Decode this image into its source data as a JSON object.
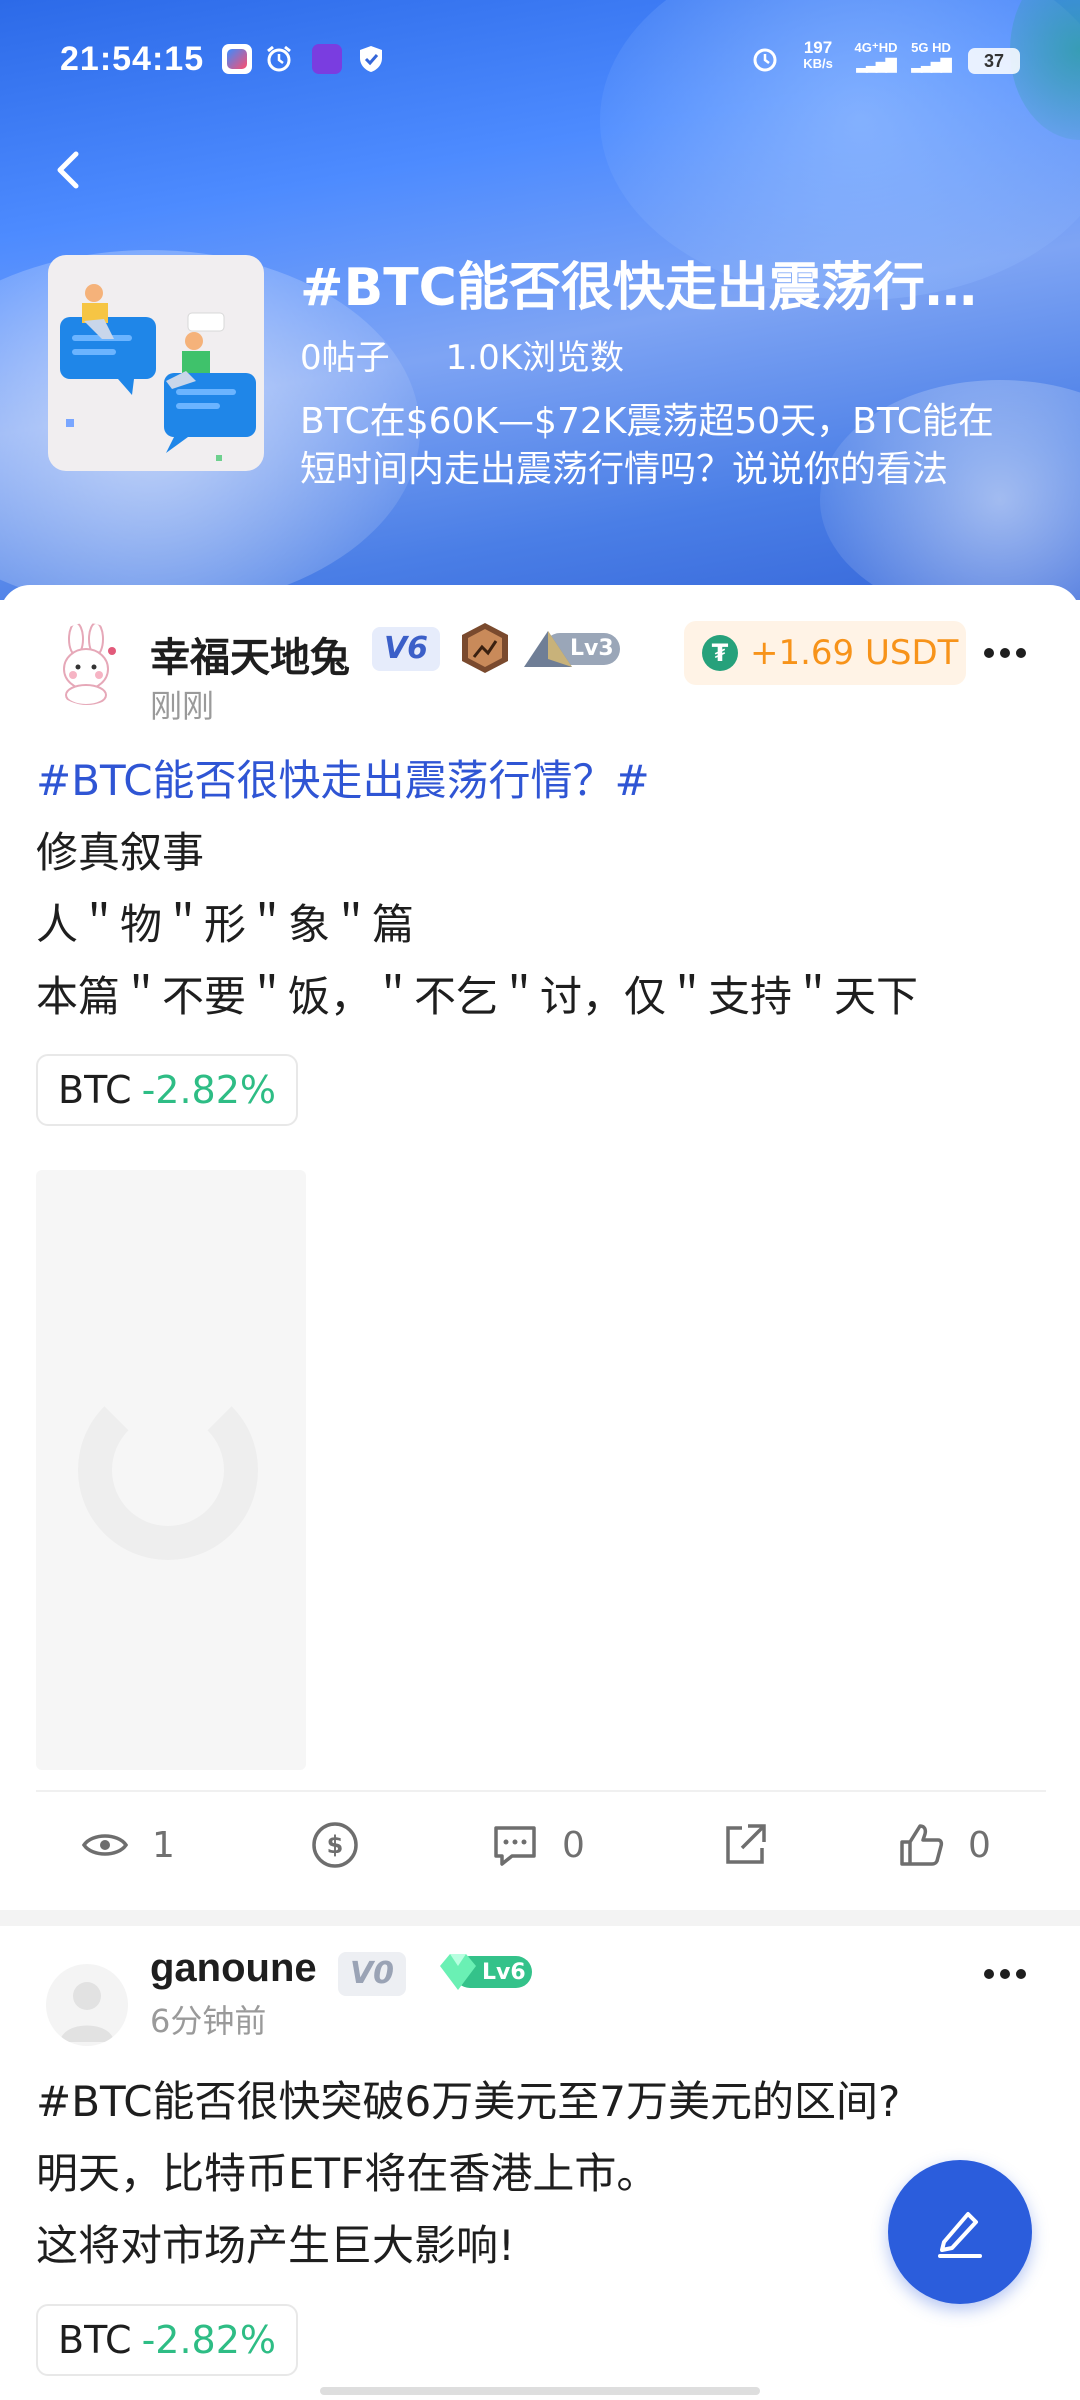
{
  "status_bar": {
    "time": "21:54:15",
    "net_speed": "197",
    "net_unit": "KB/s",
    "signal1": "4G⁺HD",
    "signal2": "5G HD",
    "battery": "37"
  },
  "topic": {
    "title": "#BTC能否很快走出震荡行情？#",
    "posts": "0帖子",
    "views": "1.0K浏览数",
    "description": "BTC在$60K—$72K震荡超50天，BTC能在短时间内走出震荡行情吗？说说你的看法"
  },
  "posts": [
    {
      "username": "幸福天地兔",
      "vip_level": "V6",
      "lv": "Lv3",
      "time": "刚刚",
      "tip": "+1.69 USDT",
      "lines": [
        "#BTC能否很快走出震荡行情？#",
        "修真叙事",
        "人＂物＂形＂象＂篇",
        "本篇＂不要＂饭，＂不乞＂讨，仅＂支持＂天下"
      ],
      "coin": {
        "symbol": "BTC",
        "change": "-2.82%"
      },
      "stats": {
        "views": "1",
        "comments": "0",
        "likes": "0"
      }
    },
    {
      "username": "ganoune",
      "vip_level": "V0",
      "lv": "Lv6",
      "time": "6分钟前",
      "lines": [
        "#BTC能否很快突破6万美元至7万美元的区间?",
        "明天，比特币ETF将在香港上市。",
        "这将对市场产生巨大影响!"
      ],
      "coin": {
        "symbol": "BTC",
        "change": "-2.82%"
      }
    }
  ],
  "colors": {
    "accent": "#2b5ddc",
    "hashtag": "#2f55d4",
    "positive": "#2ebd85",
    "tip": "#f7931a"
  },
  "icons": {
    "back": "chevron-left-icon",
    "more": "more-dots-icon",
    "views": "eye-icon",
    "tip": "tip-coin-icon",
    "comment": "comment-icon",
    "share": "share-icon",
    "like": "thumbs-up-icon",
    "compose": "pencil-icon"
  }
}
